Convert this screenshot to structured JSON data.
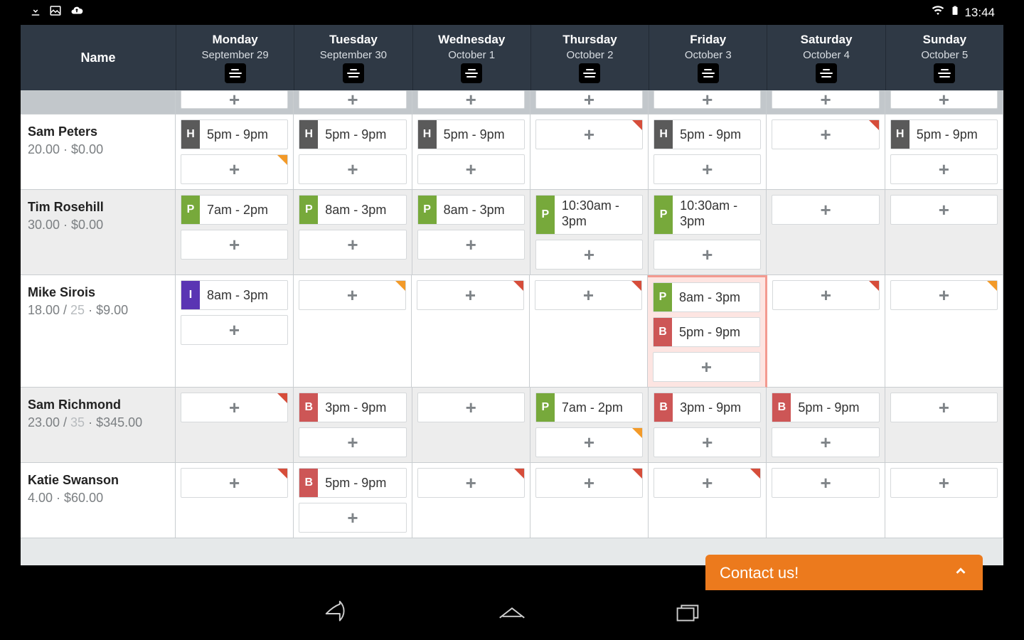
{
  "status": {
    "time": "13:44"
  },
  "nameHeader": "Name",
  "days": [
    {
      "name": "Monday",
      "date": "September 29"
    },
    {
      "name": "Tuesday",
      "date": "September 30"
    },
    {
      "name": "Wednesday",
      "date": "October 1"
    },
    {
      "name": "Thursday",
      "date": "October 2"
    },
    {
      "name": "Friday",
      "date": "October 3"
    },
    {
      "name": "Saturday",
      "date": "October 4"
    },
    {
      "name": "Sunday",
      "date": "October 5"
    }
  ],
  "employees": [
    {
      "name": "Sam Peters",
      "hours": "20.00",
      "max": null,
      "cost": "$0.00",
      "cells": [
        {
          "shifts": [
            {
              "tag": "H",
              "label": "5pm - 9pm"
            }
          ],
          "addFlag": "orange"
        },
        {
          "shifts": [
            {
              "tag": "H",
              "label": "5pm - 9pm"
            }
          ],
          "addFlag": "none"
        },
        {
          "shifts": [
            {
              "tag": "H",
              "label": "5pm - 9pm"
            }
          ],
          "addFlag": "none"
        },
        {
          "shifts": [],
          "addFlag": "red"
        },
        {
          "shifts": [
            {
              "tag": "H",
              "label": "5pm - 9pm"
            }
          ],
          "addFlag": "none"
        },
        {
          "shifts": [],
          "addFlag": "red"
        },
        {
          "shifts": [
            {
              "tag": "H",
              "label": "5pm - 9pm"
            }
          ],
          "addFlag": "none"
        }
      ]
    },
    {
      "name": "Tim Rosehill",
      "hours": "30.00",
      "max": null,
      "cost": "$0.00",
      "cells": [
        {
          "shifts": [
            {
              "tag": "P",
              "label": "7am - 2pm"
            }
          ],
          "addFlag": "none"
        },
        {
          "shifts": [
            {
              "tag": "P",
              "label": "8am - 3pm"
            }
          ],
          "addFlag": "none"
        },
        {
          "shifts": [
            {
              "tag": "P",
              "label": "8am - 3pm"
            }
          ],
          "addFlag": "none"
        },
        {
          "shifts": [
            {
              "tag": "P",
              "label": "10:30am - 3pm",
              "tall": true
            }
          ],
          "addFlag": "none"
        },
        {
          "shifts": [
            {
              "tag": "P",
              "label": "10:30am - 3pm",
              "tall": true
            }
          ],
          "addFlag": "none"
        },
        {
          "shifts": [],
          "addFlag": "none",
          "noAdd": false
        },
        {
          "shifts": [],
          "addFlag": "none",
          "noAdd": false
        }
      ]
    },
    {
      "name": "Mike Sirois",
      "hours": "18.00",
      "max": "25",
      "cost": "$9.00",
      "cells": [
        {
          "shifts": [
            {
              "tag": "I",
              "label": "8am - 3pm"
            }
          ],
          "addFlag": "none"
        },
        {
          "shifts": [],
          "addFlag": "orange"
        },
        {
          "shifts": [],
          "addFlag": "red"
        },
        {
          "shifts": [],
          "addFlag": "red"
        },
        {
          "hot": true,
          "shifts": [
            {
              "tag": "P",
              "label": "8am - 3pm"
            },
            {
              "tag": "B",
              "label": "5pm - 9pm"
            }
          ],
          "addFlag": "none"
        },
        {
          "shifts": [],
          "addFlag": "red"
        },
        {
          "shifts": [],
          "addFlag": "orange"
        }
      ]
    },
    {
      "name": "Sam Richmond",
      "hours": "23.00",
      "max": "35",
      "cost": "$345.00",
      "cells": [
        {
          "shifts": [],
          "addFlag": "red"
        },
        {
          "shifts": [
            {
              "tag": "B",
              "label": "3pm - 9pm"
            }
          ],
          "addFlag": "none"
        },
        {
          "shifts": [],
          "addFlag": "none"
        },
        {
          "shifts": [
            {
              "tag": "P",
              "label": "7am - 2pm"
            }
          ],
          "addFlag": "orange"
        },
        {
          "shifts": [
            {
              "tag": "B",
              "label": "3pm - 9pm"
            }
          ],
          "addFlag": "none"
        },
        {
          "shifts": [
            {
              "tag": "B",
              "label": "5pm - 9pm"
            }
          ],
          "addFlag": "none"
        },
        {
          "shifts": [],
          "addFlag": "none"
        }
      ]
    },
    {
      "name": "Katie Swanson",
      "hours": "4.00",
      "max": null,
      "cost": "$60.00",
      "cells": [
        {
          "shifts": [],
          "addFlag": "red"
        },
        {
          "shifts": [
            {
              "tag": "B",
              "label": "5pm - 9pm"
            }
          ],
          "addFlag": ""
        },
        {
          "shifts": [],
          "addFlag": "red"
        },
        {
          "shifts": [],
          "addFlag": "red"
        },
        {
          "shifts": [],
          "addFlag": "red"
        },
        {
          "shifts": [],
          "addFlag": ""
        },
        {
          "shifts": [],
          "addFlag": ""
        }
      ]
    }
  ],
  "contact": "Contact us!"
}
